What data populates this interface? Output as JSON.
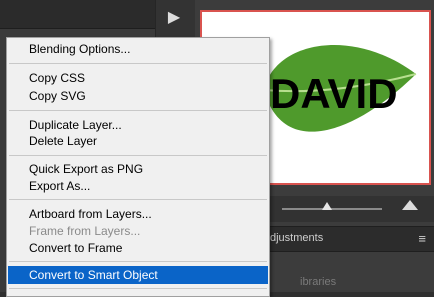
{
  "menu": {
    "items": [
      {
        "label": "Blending Options...",
        "disabled": false
      },
      {
        "label": "Copy CSS",
        "disabled": false
      },
      {
        "label": "Copy SVG",
        "disabled": false
      },
      {
        "label": "Duplicate Layer...",
        "disabled": false
      },
      {
        "label": "Delete Layer",
        "disabled": false
      },
      {
        "label": "Quick Export as PNG",
        "disabled": false
      },
      {
        "label": "Export As...",
        "disabled": false
      },
      {
        "label": "Artboard from Layers...",
        "disabled": false
      },
      {
        "label": "Frame from Layers...",
        "disabled": true
      },
      {
        "label": "Convert to Frame",
        "disabled": false
      },
      {
        "label": "Convert to Smart Object",
        "selected": true
      }
    ]
  },
  "preview": {
    "text": "DAVID"
  },
  "panels": {
    "adjustments_tab": "djustments",
    "libraries_label": "ibraries"
  },
  "colors": {
    "selection": "#0a64c8",
    "preview_border": "#d9534f",
    "leaf": "#4f9a2c"
  }
}
